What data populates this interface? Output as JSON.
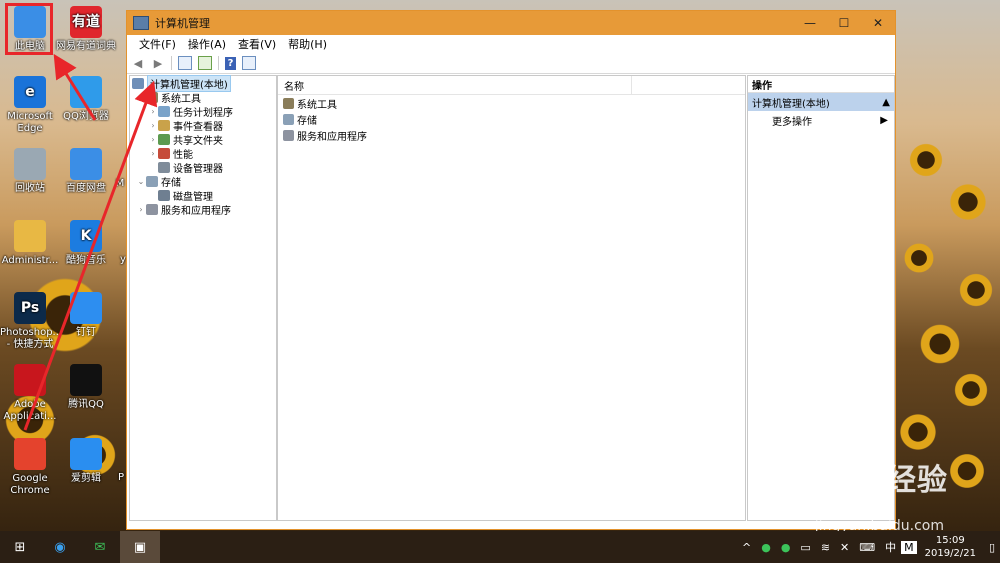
{
  "desktop": {
    "icons": [
      {
        "label": "此电脑",
        "icon": "computer-icon",
        "color": "#3a8ee6"
      },
      {
        "label": "网易有道词典",
        "icon": "youdao-icon",
        "color": "#e0262c",
        "glyph": "有道"
      },
      {
        "label": "Microsoft Edge",
        "icon": "edge-icon",
        "color": "#1a73d9",
        "glyph": "e"
      },
      {
        "label": "QQ浏览器",
        "icon": "qq-browser-icon",
        "color": "#2f9bea"
      },
      {
        "label": "回收站",
        "icon": "recycle-bin-icon",
        "color": "#9aa8b3"
      },
      {
        "label": "百度网盘",
        "icon": "baidu-pan-icon",
        "color": "#3b8ee6"
      },
      {
        "label": "Administr...",
        "icon": "user-folder-icon",
        "color": "#e8b844"
      },
      {
        "label": "酷狗音乐",
        "icon": "kugou-icon",
        "color": "#1c7ce0",
        "glyph": "K"
      },
      {
        "label": "Photoshop... - 快捷方式",
        "icon": "photoshop-icon",
        "color": "#0c2a4a",
        "glyph": "Ps"
      },
      {
        "label": "钉钉",
        "icon": "dingtalk-icon",
        "color": "#2d8ef0"
      },
      {
        "label": "Adobe Applicati...",
        "icon": "adobe-icon",
        "color": "#c8161d"
      },
      {
        "label": "腾讯QQ",
        "icon": "qq-icon",
        "color": "#111111"
      },
      {
        "label": "Google Chrome",
        "icon": "chrome-icon",
        "color": "#e4432d"
      },
      {
        "label": "爱剪辑",
        "icon": "aijianji-icon",
        "color": "#2a8ef0"
      }
    ],
    "partial_labels": [
      "M",
      "y",
      "P"
    ]
  },
  "window": {
    "title": "计算机管理",
    "menu": [
      "文件(F)",
      "操作(A)",
      "查看(V)",
      "帮助(H)"
    ],
    "controls": {
      "minimize": "—",
      "maximize": "☐",
      "close": "✕"
    }
  },
  "tree": {
    "root": "计算机管理(本地)",
    "nodes": [
      {
        "label": "系统工具",
        "expander": "⌄"
      },
      {
        "label": "任务计划程序",
        "expander": "›"
      },
      {
        "label": "事件查看器",
        "expander": "›"
      },
      {
        "label": "共享文件夹",
        "expander": "›"
      },
      {
        "label": "性能",
        "expander": "›"
      },
      {
        "label": "设备管理器",
        "expander": ""
      },
      {
        "label": "存储",
        "expander": "⌄"
      },
      {
        "label": "磁盘管理",
        "expander": ""
      },
      {
        "label": "服务和应用程序",
        "expander": "›"
      }
    ]
  },
  "list": {
    "header": "名称",
    "items": [
      "系统工具",
      "存储",
      "服务和应用程序"
    ]
  },
  "actions": {
    "title": "操作",
    "section": "计算机管理(本地)",
    "item": "更多操作"
  },
  "taskbar": {
    "tray": [
      "^",
      "中",
      "M"
    ],
    "time": "15:09",
    "date": "2019/2/21"
  },
  "watermark": {
    "main": "Bai du 经验",
    "url": "jingyan.baidu.com"
  }
}
